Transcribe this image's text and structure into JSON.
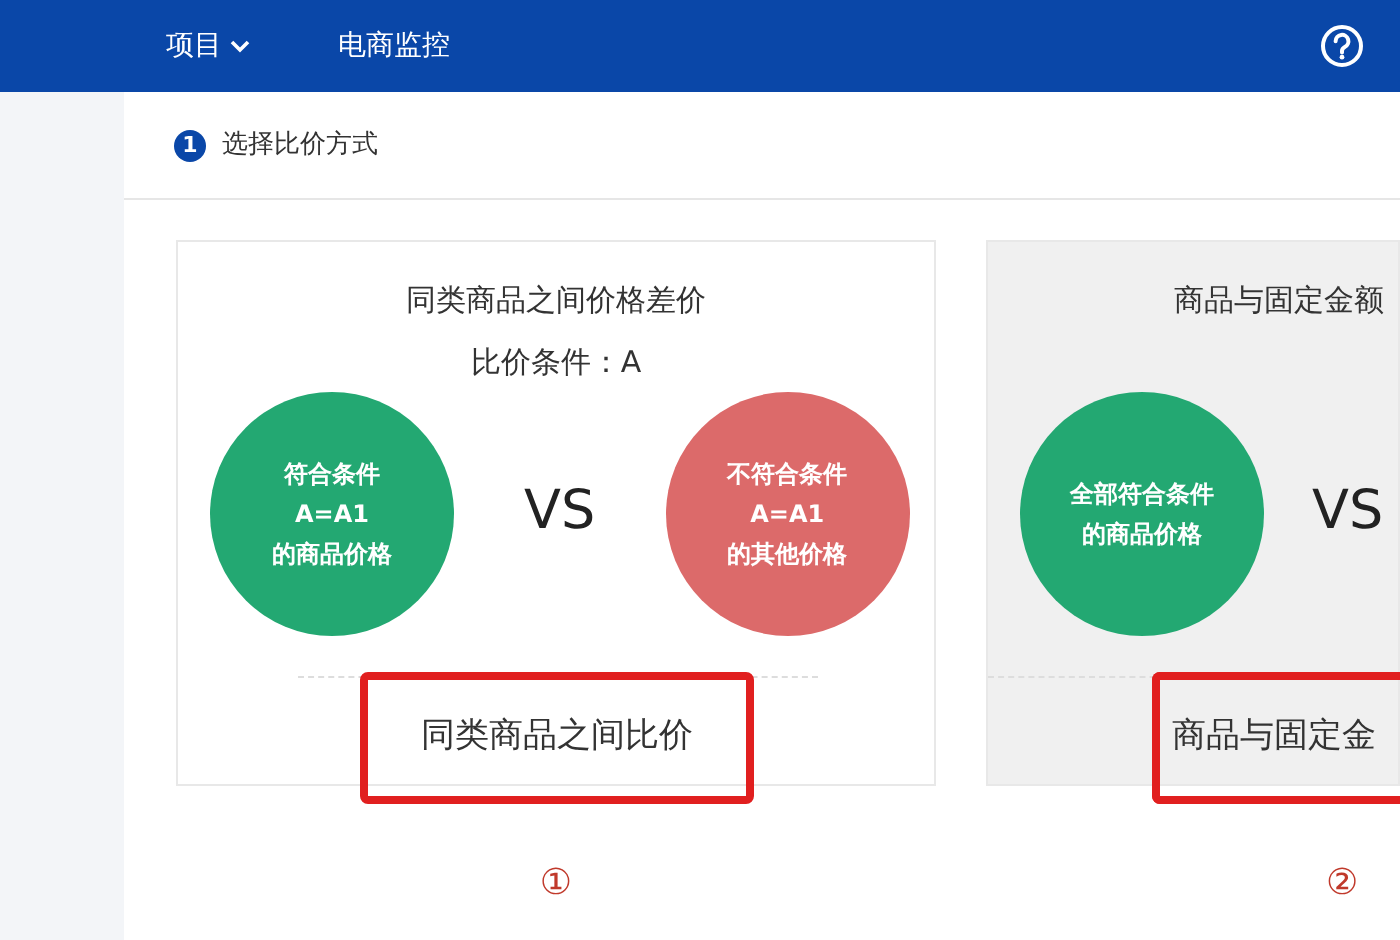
{
  "navbar": {
    "items": [
      {
        "label": "项目",
        "dropdown": true
      },
      {
        "label": "电商监控",
        "dropdown": false
      }
    ]
  },
  "step": {
    "number": "1",
    "label": "选择比价方式"
  },
  "options": [
    {
      "title": "同类商品之间价格差价",
      "condition": "比价条件：A",
      "highlighted": false,
      "circles": [
        {
          "lines": [
            "符合条件",
            "A=A1",
            "的商品价格"
          ],
          "color": "#23a872"
        },
        {
          "lines": [
            "不符合条件",
            "A=A1",
            "的其他价格"
          ],
          "color": "#dc6a6a"
        }
      ],
      "vs": "VS",
      "button": "同类商品之间比价",
      "marker": "①"
    },
    {
      "title": "商品与固定金额",
      "highlighted": true,
      "circles": [
        {
          "lines": [
            "全部符合条件",
            "的商品价格"
          ],
          "color": "#23a872"
        }
      ],
      "vs": "VS",
      "button": "商品与固定金",
      "marker": "②"
    }
  ]
}
